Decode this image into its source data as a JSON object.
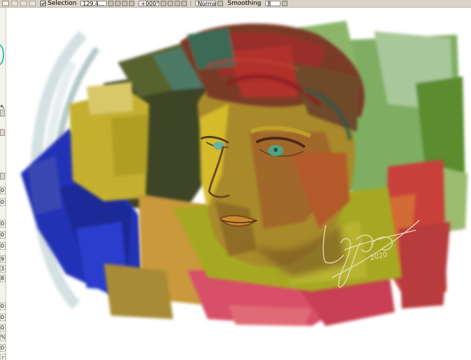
{
  "toolbar": {
    "selection_label": "Selection",
    "selection_checked": true,
    "width_value": "129.4...",
    "angle_value": "+000°",
    "blend_mode": "Normal",
    "smoothing_label": "Smoothing",
    "smoothing_value": "8"
  },
  "left_panel": {
    "values": [
      "0",
      "0",
      "0",
      "0",
      "0",
      "9",
      "3",
      "8",
      "0",
      "0",
      "0",
      "%",
      "0",
      "r"
    ]
  },
  "canvas": {
    "signature_text": "2020",
    "colors": {
      "background": "#ffffff",
      "skin": "#a98a2c",
      "hair": "#8a2f25",
      "blue": "#1f2fb4",
      "yellow": "#c8b52e",
      "green": "#6f9a2a",
      "red": "#d84a4c",
      "eye": "#4fa487"
    }
  }
}
